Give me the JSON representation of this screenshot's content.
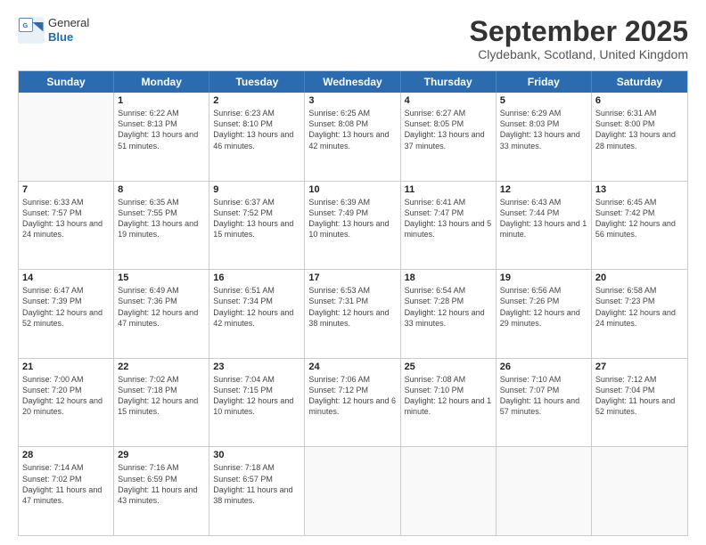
{
  "header": {
    "logo": {
      "general": "General",
      "blue": "Blue"
    },
    "title": "September 2025",
    "location": "Clydebank, Scotland, United Kingdom"
  },
  "calendar": {
    "days_of_week": [
      "Sunday",
      "Monday",
      "Tuesday",
      "Wednesday",
      "Thursday",
      "Friday",
      "Saturday"
    ],
    "weeks": [
      [
        {
          "day": "",
          "empty": true
        },
        {
          "day": "1",
          "sunrise": "6:22 AM",
          "sunset": "8:13 PM",
          "daylight": "13 hours and 51 minutes."
        },
        {
          "day": "2",
          "sunrise": "6:23 AM",
          "sunset": "8:10 PM",
          "daylight": "13 hours and 46 minutes."
        },
        {
          "day": "3",
          "sunrise": "6:25 AM",
          "sunset": "8:08 PM",
          "daylight": "13 hours and 42 minutes."
        },
        {
          "day": "4",
          "sunrise": "6:27 AM",
          "sunset": "8:05 PM",
          "daylight": "13 hours and 37 minutes."
        },
        {
          "day": "5",
          "sunrise": "6:29 AM",
          "sunset": "8:03 PM",
          "daylight": "13 hours and 33 minutes."
        },
        {
          "day": "6",
          "sunrise": "6:31 AM",
          "sunset": "8:00 PM",
          "daylight": "13 hours and 28 minutes."
        }
      ],
      [
        {
          "day": "7",
          "sunrise": "6:33 AM",
          "sunset": "7:57 PM",
          "daylight": "13 hours and 24 minutes."
        },
        {
          "day": "8",
          "sunrise": "6:35 AM",
          "sunset": "7:55 PM",
          "daylight": "13 hours and 19 minutes."
        },
        {
          "day": "9",
          "sunrise": "6:37 AM",
          "sunset": "7:52 PM",
          "daylight": "13 hours and 15 minutes."
        },
        {
          "day": "10",
          "sunrise": "6:39 AM",
          "sunset": "7:49 PM",
          "daylight": "13 hours and 10 minutes."
        },
        {
          "day": "11",
          "sunrise": "6:41 AM",
          "sunset": "7:47 PM",
          "daylight": "13 hours and 5 minutes."
        },
        {
          "day": "12",
          "sunrise": "6:43 AM",
          "sunset": "7:44 PM",
          "daylight": "13 hours and 1 minute."
        },
        {
          "day": "13",
          "sunrise": "6:45 AM",
          "sunset": "7:42 PM",
          "daylight": "12 hours and 56 minutes."
        }
      ],
      [
        {
          "day": "14",
          "sunrise": "6:47 AM",
          "sunset": "7:39 PM",
          "daylight": "12 hours and 52 minutes."
        },
        {
          "day": "15",
          "sunrise": "6:49 AM",
          "sunset": "7:36 PM",
          "daylight": "12 hours and 47 minutes."
        },
        {
          "day": "16",
          "sunrise": "6:51 AM",
          "sunset": "7:34 PM",
          "daylight": "12 hours and 42 minutes."
        },
        {
          "day": "17",
          "sunrise": "6:53 AM",
          "sunset": "7:31 PM",
          "daylight": "12 hours and 38 minutes."
        },
        {
          "day": "18",
          "sunrise": "6:54 AM",
          "sunset": "7:28 PM",
          "daylight": "12 hours and 33 minutes."
        },
        {
          "day": "19",
          "sunrise": "6:56 AM",
          "sunset": "7:26 PM",
          "daylight": "12 hours and 29 minutes."
        },
        {
          "day": "20",
          "sunrise": "6:58 AM",
          "sunset": "7:23 PM",
          "daylight": "12 hours and 24 minutes."
        }
      ],
      [
        {
          "day": "21",
          "sunrise": "7:00 AM",
          "sunset": "7:20 PM",
          "daylight": "12 hours and 20 minutes."
        },
        {
          "day": "22",
          "sunrise": "7:02 AM",
          "sunset": "7:18 PM",
          "daylight": "12 hours and 15 minutes."
        },
        {
          "day": "23",
          "sunrise": "7:04 AM",
          "sunset": "7:15 PM",
          "daylight": "12 hours and 10 minutes."
        },
        {
          "day": "24",
          "sunrise": "7:06 AM",
          "sunset": "7:12 PM",
          "daylight": "12 hours and 6 minutes."
        },
        {
          "day": "25",
          "sunrise": "7:08 AM",
          "sunset": "7:10 PM",
          "daylight": "12 hours and 1 minute."
        },
        {
          "day": "26",
          "sunrise": "7:10 AM",
          "sunset": "7:07 PM",
          "daylight": "11 hours and 57 minutes."
        },
        {
          "day": "27",
          "sunrise": "7:12 AM",
          "sunset": "7:04 PM",
          "daylight": "11 hours and 52 minutes."
        }
      ],
      [
        {
          "day": "28",
          "sunrise": "7:14 AM",
          "sunset": "7:02 PM",
          "daylight": "11 hours and 47 minutes."
        },
        {
          "day": "29",
          "sunrise": "7:16 AM",
          "sunset": "6:59 PM",
          "daylight": "11 hours and 43 minutes."
        },
        {
          "day": "30",
          "sunrise": "7:18 AM",
          "sunset": "6:57 PM",
          "daylight": "11 hours and 38 minutes."
        },
        {
          "day": "",
          "empty": true
        },
        {
          "day": "",
          "empty": true
        },
        {
          "day": "",
          "empty": true
        },
        {
          "day": "",
          "empty": true
        }
      ]
    ]
  }
}
